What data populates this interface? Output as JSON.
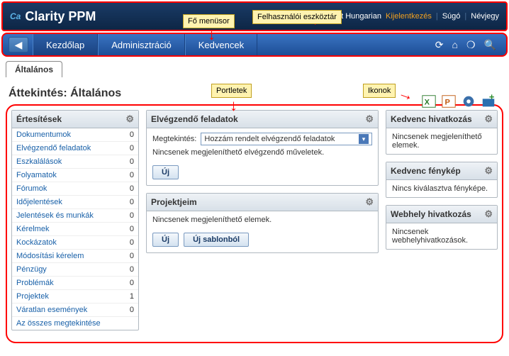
{
  "header": {
    "app_name": "Clarity PPM",
    "user_name": "Test Hungarian",
    "logout": "Kijelentkezés",
    "help": "Súgó",
    "about": "Névjegy"
  },
  "menu": {
    "home": "Kezdőlap",
    "admin": "Adminisztráció",
    "fav": "Kedvencek"
  },
  "callouts": {
    "main_menu": "Fő menüsor",
    "user_toolbar": "Felhasználói eszköztár",
    "portlets": "Portletek",
    "icons": "Ikonok"
  },
  "tab_general": "Általános",
  "page_title": "Áttekintés: Általános",
  "notifications": {
    "title": "Értesítések",
    "items": [
      {
        "label": "Dokumentumok",
        "count": "0"
      },
      {
        "label": "Elvégzendő feladatok",
        "count": "0"
      },
      {
        "label": "Eszkalálások",
        "count": "0"
      },
      {
        "label": "Folyamatok",
        "count": "0"
      },
      {
        "label": "Fórumok",
        "count": "0"
      },
      {
        "label": "Időjelentések",
        "count": "0"
      },
      {
        "label": "Jelentések és munkák",
        "count": "0"
      },
      {
        "label": "Kérelmek",
        "count": "0"
      },
      {
        "label": "Kockázatok",
        "count": "0"
      },
      {
        "label": "Módosítási kérelem",
        "count": "0"
      },
      {
        "label": "Pénzügy",
        "count": "0"
      },
      {
        "label": "Problémák",
        "count": "0"
      },
      {
        "label": "Projektek",
        "count": "1"
      },
      {
        "label": "Váratlan események",
        "count": "0"
      }
    ],
    "view_all": "Az összes megtekintése"
  },
  "todos": {
    "title": "Elvégzendő feladatok",
    "view_label": "Megtekintés:",
    "view_value": "Hozzám rendelt elvégzendő feladatok",
    "empty": "Nincsenek megjeleníthető elvégzendő műveletek.",
    "new_btn": "Új"
  },
  "projects": {
    "title": "Projektjeim",
    "empty": "Nincsenek megjeleníthető elemek.",
    "new_btn": "Új",
    "new_tpl_btn": "Új sablonból"
  },
  "fav_links": {
    "title": "Kedvenc hivatkozás",
    "body": "Nincsenek megjeleníthető elemek."
  },
  "fav_photo": {
    "title": "Kedvenc fénykép",
    "body": "Nincs kiválasztva fényképe."
  },
  "site_links": {
    "title": "Webhely hivatkozás",
    "body": "Nincsenek webhelyhivatkozások."
  }
}
